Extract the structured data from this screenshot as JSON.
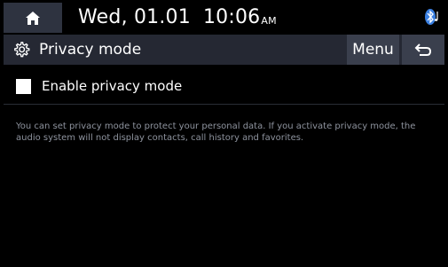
{
  "status_bar": {
    "date": "Wed, 01.01",
    "time": "10:06",
    "ampm": "AM",
    "home_icon": "home-icon",
    "bluetooth_icon": "bluetooth-audio-icon"
  },
  "title_bar": {
    "title": "Privacy mode",
    "settings_icon": "gear-icon",
    "menu_label": "Menu",
    "back_icon": "back-arrow-icon"
  },
  "option": {
    "label": "Enable privacy mode",
    "checked": false
  },
  "description": "You can set privacy mode to protect your personal data. If you activate privacy mode, the audio system will not display contacts, call history and favorites.",
  "colors": {
    "background": "#000000",
    "title_bar": "#252833",
    "button": "#3a3f4d",
    "description_text": "#8e939e"
  }
}
